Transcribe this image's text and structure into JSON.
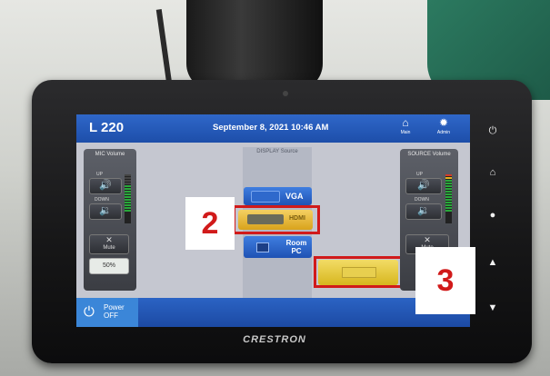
{
  "header": {
    "room": "L 220",
    "datetime": "September 8, 2021 10:46 AM",
    "home_label": "Main",
    "admin_label": "Admin"
  },
  "mic_volume": {
    "title": "MIC Volume",
    "up_label": "UP",
    "down_label": "DOWN",
    "mute_label": "Mute",
    "level_text": "50%",
    "up_icon": "speaker-up-icon",
    "down_icon": "speaker-down-icon"
  },
  "display": {
    "title": "DISPLAY Source",
    "sources": [
      {
        "label": "VGA",
        "selected": false
      },
      {
        "label": "HDMI",
        "selected": true
      },
      {
        "label": "Room PC",
        "selected": false
      }
    ]
  },
  "source_volume": {
    "title": "SOURCE Volume",
    "up_label": "UP",
    "down_label": "DOWN",
    "mute_label": "Mute"
  },
  "power": {
    "label": "Power OFF"
  },
  "annotations": {
    "label_2": "2",
    "label_3": "3"
  },
  "device": {
    "brand": "CRESTRON"
  },
  "colors": {
    "topbar": "#1d4ea9",
    "selected_source": "#e6b62d",
    "annotation_red": "#d11a1a"
  }
}
